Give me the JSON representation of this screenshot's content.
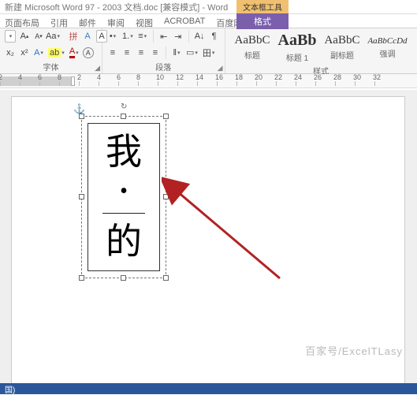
{
  "title": "新建 Microsoft Word 97 - 2003 文档.doc [兼容模式] - Word",
  "contextual_tab": {
    "group_title": "文本框工具",
    "tab_label": "格式"
  },
  "tabs": [
    "页面布局",
    "引用",
    "邮件",
    "审阅",
    "视图",
    "ACROBAT",
    "百度网盘"
  ],
  "font_group": {
    "label": "字体",
    "size_dropdown": "",
    "buttons": {
      "grow": "A",
      "shrink": "A",
      "case": "Aa",
      "clear_format": "A",
      "phonetic": "拼",
      "enclosing": "A",
      "border": "A",
      "bold_small": "x²",
      "sub": "x₂",
      "effects": "A",
      "highlight": "ab",
      "font_color": "A"
    }
  },
  "paragraph_group": {
    "label": "段落",
    "buttons": {
      "bullets": "•",
      "numbering": "1.",
      "multilevel": "≡",
      "indent_dec": "⇤",
      "indent_inc": "⇥",
      "align_left": "≡",
      "center": "≡",
      "align_right": "≡",
      "justify": "≡",
      "line_spacing": "‖",
      "shading": "▭",
      "borders": "田",
      "sort": "A↓",
      "show_marks": "¶"
    }
  },
  "styles_group": {
    "label": "样式",
    "items": [
      {
        "preview": "AaBbC",
        "label": "标题",
        "size": "15px",
        "weight": "400"
      },
      {
        "preview": "AaBb",
        "label": "标题 1",
        "size": "20px",
        "weight": "700"
      },
      {
        "preview": "AaBbC",
        "label": "副标题",
        "size": "15px",
        "weight": "400"
      },
      {
        "preview": "AaBbCcDd",
        "label": "强调",
        "size": "11px",
        "weight": "400",
        "italic": true
      }
    ]
  },
  "ruler_numbers": [
    "2",
    "4",
    "6",
    "8",
    "2",
    "4",
    "6",
    "8",
    "10",
    "12",
    "14",
    "16",
    "18",
    "20",
    "22",
    "24",
    "26",
    "28",
    "30",
    "32"
  ],
  "document": {
    "textbox_lines": {
      "line1": "我",
      "dot": "•",
      "line2": "的"
    },
    "anchor_icon": "⚓"
  },
  "watermark": "百家号/ExcelTLasy",
  "status": "国)"
}
